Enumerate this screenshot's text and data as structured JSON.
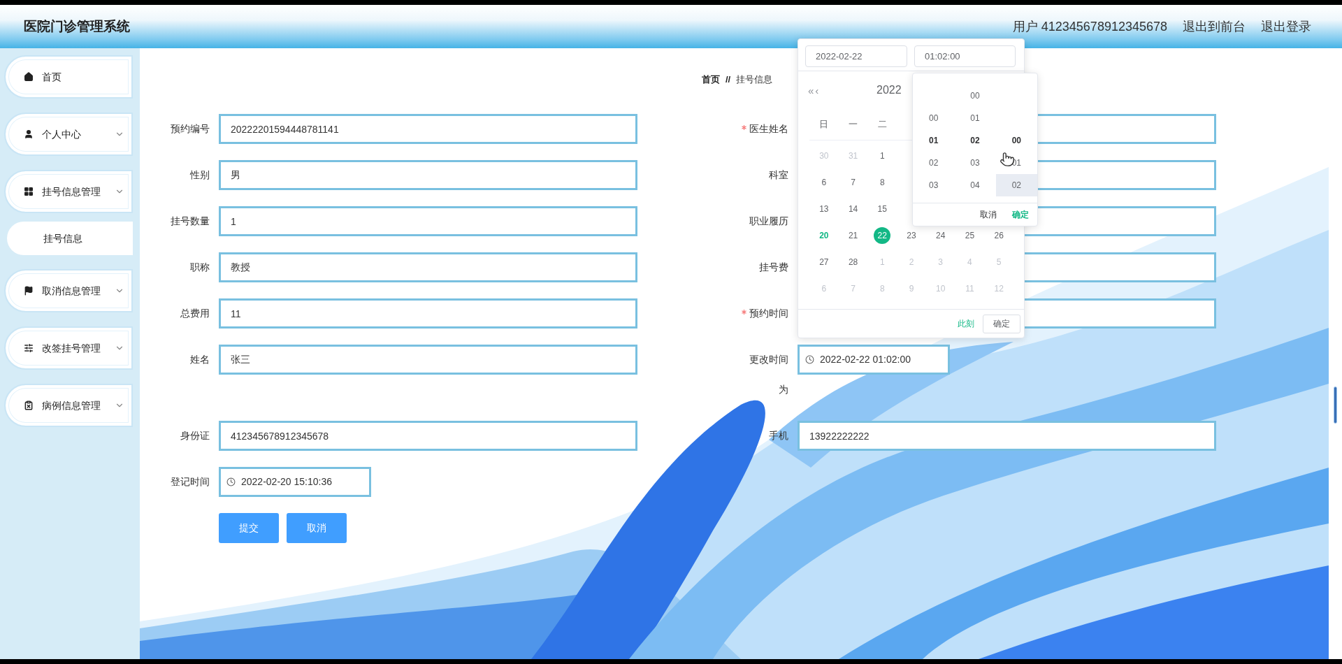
{
  "header": {
    "title": "医院门诊管理系统",
    "user": "用户 412345678912345678",
    "links": [
      "退出到前台",
      "退出登录"
    ]
  },
  "sidebar": {
    "items": [
      {
        "label": "首页",
        "expandable": false
      },
      {
        "label": "个人中心",
        "expandable": true
      },
      {
        "label": "挂号信息管理",
        "expandable": true,
        "children": [
          {
            "label": "挂号信息"
          }
        ]
      },
      {
        "label": "取消信息管理",
        "expandable": true
      },
      {
        "label": "改签挂号管理",
        "expandable": true
      },
      {
        "label": "病例信息管理",
        "expandable": true
      }
    ]
  },
  "breadcrumb": {
    "items": [
      "首页",
      "挂号信息"
    ],
    "separator": "//"
  },
  "form": {
    "left": [
      {
        "label": "预约编号",
        "kind": "text",
        "required": false,
        "value": "20222201594448781141"
      },
      {
        "label": "性别",
        "kind": "text",
        "required": false,
        "value": "男"
      },
      {
        "label": "挂号数量",
        "kind": "text",
        "required": false,
        "value": "1"
      },
      {
        "label": "职称",
        "kind": "text",
        "required": false,
        "value": "教授"
      },
      {
        "label": "总费用",
        "kind": "text",
        "required": false,
        "value": "11"
      },
      {
        "label": "姓名",
        "kind": "text",
        "required": false,
        "value": "张三"
      },
      {
        "label": "身份证",
        "kind": "text",
        "required": false,
        "value": "412345678912345678"
      },
      {
        "label": "登记时间",
        "kind": "date",
        "required": false,
        "value": "2022-02-20 15:10:36"
      }
    ],
    "right": [
      {
        "label": "医生姓名",
        "kind": "text",
        "required": true
      },
      {
        "label": "科室",
        "kind": "text",
        "required": false
      },
      {
        "label": "职业履历",
        "kind": "text",
        "required": false
      },
      {
        "label": "挂号费",
        "kind": "text",
        "required": false
      },
      {
        "label": "预约时间",
        "kind": "text",
        "required": true
      },
      {
        "label": "更改时间为",
        "kind": "date",
        "required": false,
        "value": "2022-02-22 01:02:00"
      },
      {
        "label": "手机",
        "kind": "text",
        "required": false,
        "value": "13922222222"
      }
    ],
    "buttons": [
      "提交",
      "取消"
    ]
  },
  "picker": {
    "date_value": "2022-02-22",
    "time_value": "01:02:00",
    "nav": [
      "«",
      "‹"
    ],
    "heading": "2022",
    "weekdays": [
      "日",
      "一",
      "二"
    ],
    "weeks": [
      [
        {
          "day": "30",
          "muted": true,
          "today": false,
          "selected": false
        },
        {
          "day": "31",
          "muted": true,
          "today": false,
          "selected": false
        },
        {
          "day": "1",
          "muted": false,
          "today": false,
          "selected": false
        }
      ],
      [
        {
          "day": "6",
          "muted": false,
          "today": false,
          "selected": false
        },
        {
          "day": "7",
          "muted": false,
          "today": false,
          "selected": false
        },
        {
          "day": "8",
          "muted": false,
          "today": false,
          "selected": false
        }
      ],
      [
        {
          "day": "13",
          "muted": false,
          "today": false,
          "selected": false
        },
        {
          "day": "14",
          "muted": false,
          "today": false,
          "selected": false
        },
        {
          "day": "15",
          "muted": false,
          "today": false,
          "selected": false
        }
      ],
      [
        {
          "day": "20",
          "muted": false,
          "today": true,
          "selected": false
        },
        {
          "day": "21",
          "muted": false,
          "today": false,
          "selected": false
        },
        {
          "day": "22",
          "muted": false,
          "today": false,
          "selected": true
        },
        {
          "day": "23",
          "muted": false,
          "today": false,
          "selected": false
        },
        {
          "day": "24",
          "muted": false,
          "today": false,
          "selected": false
        },
        {
          "day": "25",
          "muted": false,
          "today": false,
          "selected": false
        },
        {
          "day": "26",
          "muted": false,
          "today": false,
          "selected": false
        }
      ],
      [
        {
          "day": "27",
          "muted": false,
          "today": false,
          "selected": false
        },
        {
          "day": "28",
          "muted": false,
          "today": false,
          "selected": false
        },
        {
          "day": "1",
          "muted": true,
          "today": false,
          "selected": false
        },
        {
          "day": "2",
          "muted": true,
          "today": false,
          "selected": false
        },
        {
          "day": "3",
          "muted": true,
          "today": false,
          "selected": false
        },
        {
          "day": "4",
          "muted": true,
          "today": false,
          "selected": false
        },
        {
          "day": "5",
          "muted": true,
          "today": false,
          "selected": false
        }
      ],
      [
        {
          "day": "6",
          "muted": true,
          "today": false,
          "selected": false
        },
        {
          "day": "7",
          "muted": true,
          "today": false,
          "selected": false
        },
        {
          "day": "8",
          "muted": true,
          "today": false,
          "selected": false
        },
        {
          "day": "9",
          "muted": true,
          "today": false,
          "selected": false
        },
        {
          "day": "10",
          "muted": true,
          "today": false,
          "selected": false
        },
        {
          "day": "11",
          "muted": true,
          "today": false,
          "selected": false
        },
        {
          "day": "12",
          "muted": true,
          "today": false,
          "selected": false
        }
      ]
    ],
    "now_link": "此刻",
    "confirm": "确定"
  },
  "time_panel": {
    "columns": [
      {
        "items": [
          {
            "text": "00",
            "selected": false,
            "hovered": false
          },
          {
            "text": "01",
            "selected": true,
            "hovered": false
          },
          {
            "text": "02",
            "selected": false,
            "hovered": false
          },
          {
            "text": "03",
            "selected": false,
            "hovered": false
          }
        ]
      },
      {
        "items": [
          {
            "text": "00",
            "selected": false,
            "hovered": false
          },
          {
            "text": "01",
            "selected": false,
            "hovered": false
          },
          {
            "text": "02",
            "selected": true,
            "hovered": false
          },
          {
            "text": "03",
            "selected": false,
            "hovered": false
          },
          {
            "text": "04",
            "selected": false,
            "hovered": false
          }
        ]
      },
      {
        "items": [
          {
            "text": "00",
            "selected": true,
            "hovered": false
          },
          {
            "text": "01",
            "selected": false,
            "hovered": false
          },
          {
            "text": "02",
            "selected": false,
            "hovered": true
          }
        ]
      }
    ],
    "cancel": "取消",
    "confirm": "确定"
  }
}
